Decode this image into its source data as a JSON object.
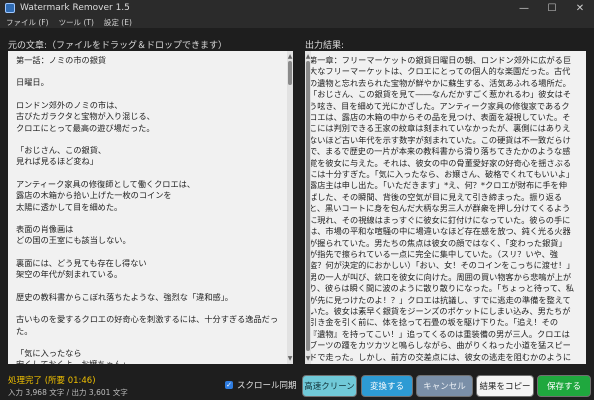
{
  "window": {
    "title": "Watermark Remover 1.5",
    "minimize": "—",
    "maximize": "☐",
    "close": "✕"
  },
  "menu": [
    "ファイル (F)",
    "ツール (T)",
    "設定 (E)"
  ],
  "left": {
    "label": "元の文章:（ファイルをドラッグ＆ドロップできます）",
    "paragraphs": [
      "第一話：ノミの市の銀貨",
      "日曜日。",
      "ロンドン郊外のノミの市は、\n古びたガラクタと宝物が入り混じる、\nクロエにとって最高の遊び場だった。",
      "「おじさん、この銀貨、\n見れば見るほど変ね」",
      "アンティーク家具の修復師として働くクロエは、\n露店の木箱から拾い上げた一枚のコインを\n太陽に透かして目を細めた。",
      "表面の肖像画は\nどの国の王室にも該当しない。",
      "裏面には、どう見ても存在し得ない\n架空の年代が刻まれている。",
      "歴史の教科書からこぼれ落ちたような、強烈な「違和感」。",
      "古いものを愛するクロエの好奇心を刺激するには、十分すぎる逸品だった。",
      "「気に入ったなら\n安くしておくよ、お嬢ちゃん」"
    ]
  },
  "right": {
    "label": "出力結果:",
    "text": "第一章：フリーマーケットの銀貨日曜日の朝、ロンドン郊外に広がる巨大なフリーマーケットは、クロエにとっての個人的な楽園だった。古代の遺物と忘れ去られた宝物が鮮やかに蘇生する、活気あふれる場所だ。「おじさん、この銀貨を見て――なんだかすごく惹かれるわ」彼女はそう呟き、目を細めて光にかざした。アンティーク家具の修復家であるクロエは、露店の木箱の中からその品を見つけ、表面を凝視していた。そこには判別できる王家の紋章は刻まれていなかったが、裏側にはありえないほど古い年代を示す数字が刻まれていた。この硬貨は不一致だらけで、まるで歴史の一片が本来の教科書から滑り落ちてきたかのような感覚を彼女に与えた。それは、彼女の中の骨董愛好家の好奇心を揺さぶるには十分すぎた。「気に入ったなら、お嬢さん、破格でくれてもいいよ」露店主は申し出た。「いただきます」*え、何？*クロエが財布に手を伸ばした、その瞬間、背後の空気が目に見えて引き締まった。振り返ると、黒いコートに身を包んだ大柄な男三人が群衆を押し分けてくるように現れ、その視線はまっすぐに彼女に釘付けになっていた。彼らの手には、市場の平和な喧騒の中に場違いなほど存在感を放つ、鈍く光る火器が握られていた。男たちの焦点は彼女の顔ではなく、「変わった銀貨」が指先で擦られている一点に完全に集中していた。（スリ？いや、強盗？何が決定的におかしい）「おい、女！そのコインをこっちに渡せ！」男の一人が叫び、銃口を彼女に向けた。周囲の買い物客から悲鳴が上がり、彼らは瞬く間に波のように散り散りになった。「ちょっと待って、私が先に見つけたのよ！？」クロエは抗議し、すでに逃走の準備を整えていた。彼女は素早く銀貨をジーンズのポケットにしまい込み、男たちが引き金を引く前に、体を捻って石畳の坂を駆け下りた。「追え！その『遺物』を持ってこい！」追ってくるのは重装備の男が三人。クロエはブーツの踵をカツカツと鳴らしながら、曲がりくねった小道を猛スピードで走った。しかし、前方の交差点には、彼女の逃走を阻むかのように黒服の男たちが姿を現していた。これは偶然、あるいは死活問題だった――だが、奇跡的に、彼女の逃路の真上に、巨大なクレーン車のアームが揺れていた。"
  },
  "status": "処理完了 (所要 01:46)",
  "counts": "入力 3,968 文字 / 出力 3,601 文字",
  "sync": {
    "label": "スクロール同期",
    "checked": true
  },
  "buttons": [
    {
      "label": "高速クリーン",
      "bg": "#70c9d8",
      "fg": "#103238"
    },
    {
      "label": "変換する",
      "bg": "#2d9bd4",
      "fg": "#ffffff"
    },
    {
      "label": "キャンセル",
      "bg": "#7a8fa8",
      "fg": "#eef2f7"
    },
    {
      "label": "結果をコピー",
      "bg": "#f4f4f4",
      "fg": "#222222"
    },
    {
      "label": "保存する",
      "bg": "#1fa83e",
      "fg": "#ffffff"
    }
  ]
}
